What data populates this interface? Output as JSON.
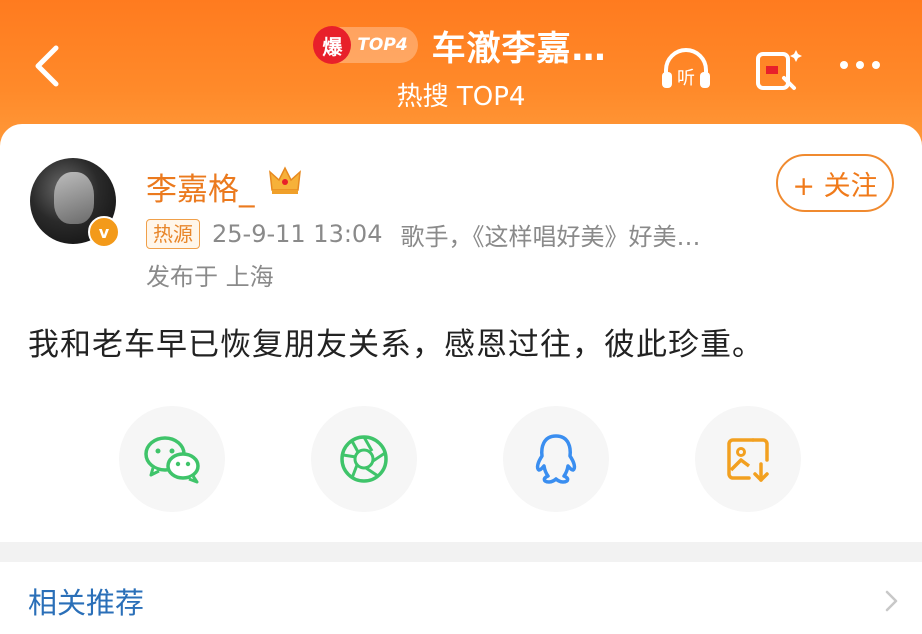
{
  "header": {
    "badge_char": "爆",
    "badge_rank": "TOP4",
    "title": "车澈李嘉…",
    "subtitle": "热搜 TOP4",
    "listen_label": "听"
  },
  "post": {
    "username": "李嘉格_",
    "follow_label": "+ 关注",
    "hot_tag": "热源",
    "timestamp": "25-9-11 13:04",
    "bio": "歌手，《这样唱好美》好美…",
    "location": "发布于 上海",
    "content": "我和老车早已恢复朋友关系，感恩过往，彼此珍重。",
    "verified_mark": "v"
  },
  "share": {
    "icons": [
      "wechat-icon",
      "moments-icon",
      "qq-icon",
      "save-image-icon"
    ],
    "colors": {
      "wechat": "#3fc46a",
      "moments": "#3fc46a",
      "qq": "#3a8ef0",
      "save": "#f2a020"
    }
  },
  "related": {
    "label": "相关推荐"
  },
  "colors": {
    "accent": "#ff7b1f",
    "link": "#2a6fb8",
    "username": "#eb7a1e"
  }
}
